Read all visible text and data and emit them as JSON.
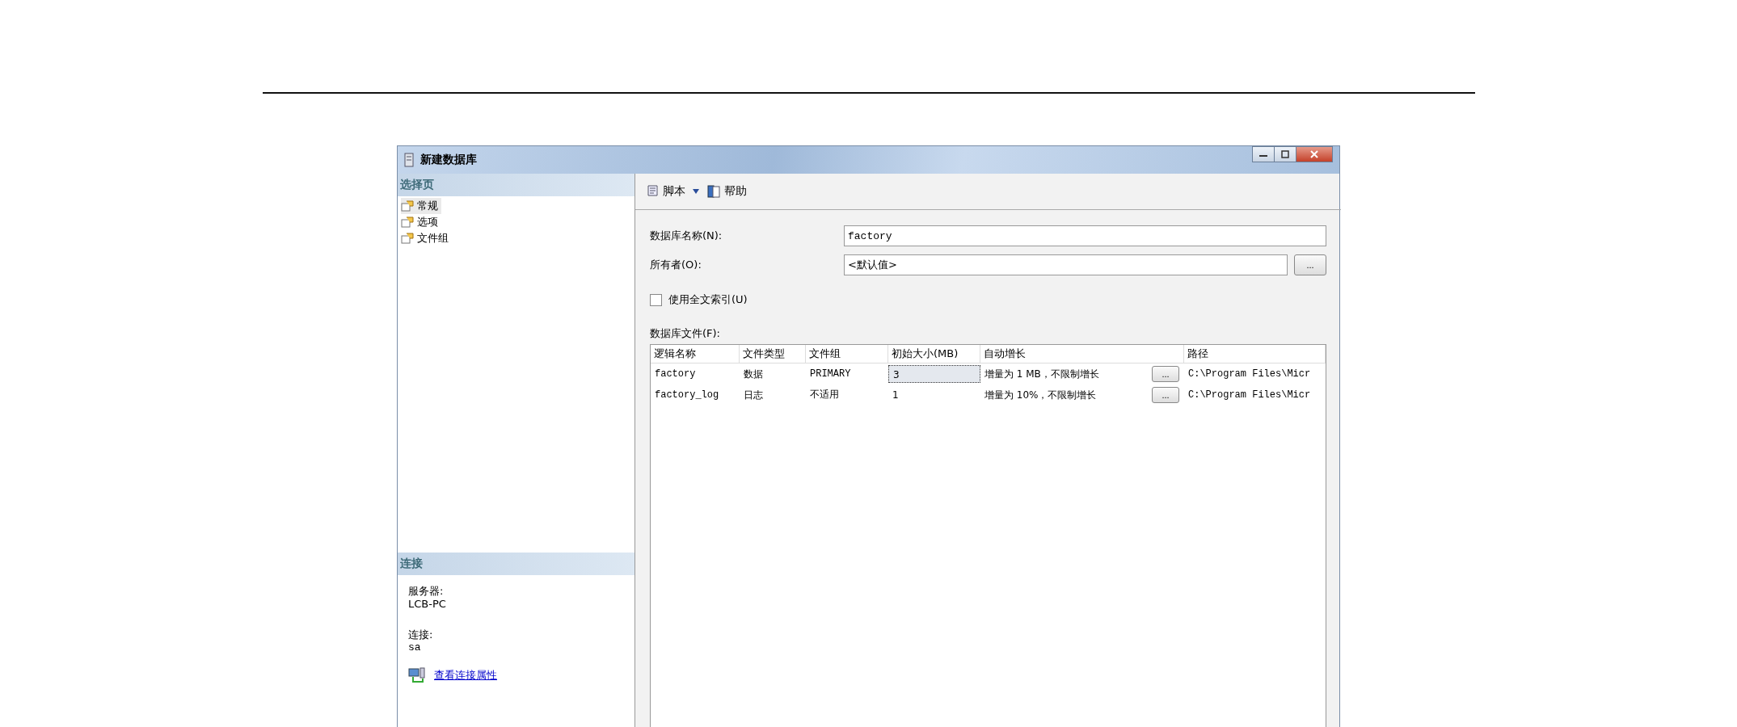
{
  "window": {
    "title": "新建数据库"
  },
  "sidebar": {
    "header": "选择页",
    "items": [
      {
        "label": "常规",
        "selected": true
      },
      {
        "label": "选项",
        "selected": false
      },
      {
        "label": "文件组",
        "selected": false
      }
    ]
  },
  "connection": {
    "header": "连接",
    "server_label": "服务器:",
    "server": "LCB-PC",
    "connection_label": "连接:",
    "connection": "sa",
    "link": "查看连接属性"
  },
  "toolbar": {
    "script": "脚本",
    "help": "帮助"
  },
  "form": {
    "name_label": "数据库名称(N):",
    "name_value": "factory",
    "owner_label": "所有者(O):",
    "owner_value": "<默认值>",
    "browse": "...",
    "fulltext": {
      "label": "使用全文索引(U)",
      "checked": false
    },
    "files_label": "数据库文件(F):"
  },
  "table": {
    "columns": [
      "逻辑名称",
      "文件类型",
      "文件组",
      "初始大小(MB)",
      "自动增长",
      "路径"
    ],
    "rows": [
      {
        "cells": [
          "factory",
          "数据",
          "PRIMARY",
          "3",
          "增量为 1 MB，不限制增长",
          "C:\\Program Files\\Micr"
        ],
        "focused": true,
        "button": "..."
      },
      {
        "cells": [
          "factory_log",
          "日志",
          "不适用",
          "1",
          "增量为 10%，不限制增长",
          "C:\\Program Files\\Micr"
        ],
        "focused": false,
        "button": "..."
      }
    ]
  }
}
